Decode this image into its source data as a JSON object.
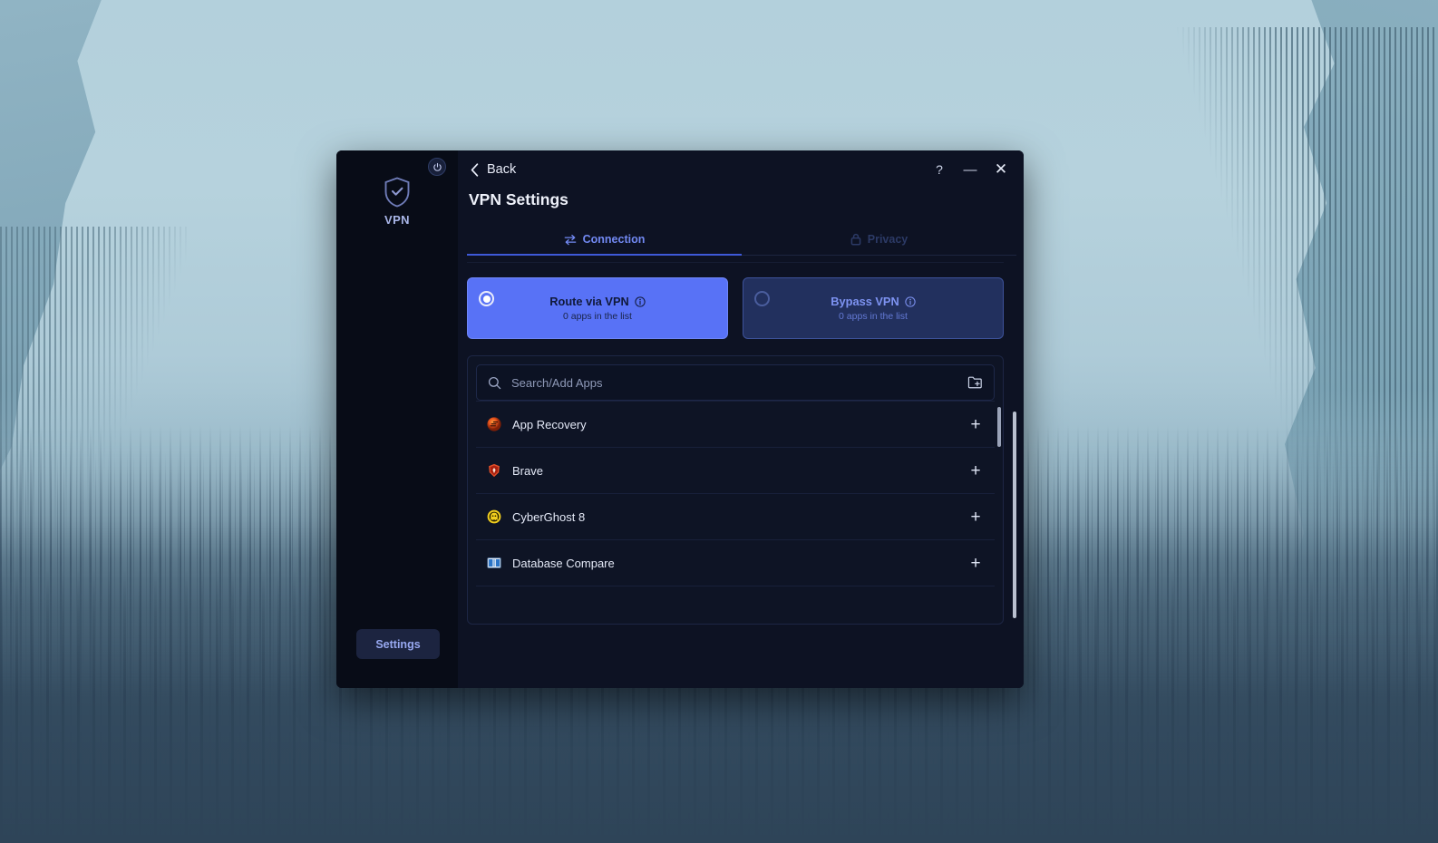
{
  "window": {
    "back_label": "Back",
    "page_title": "VPN Settings",
    "help_label": "?",
    "minimize_label": "—",
    "close_label": "✕"
  },
  "sidebar": {
    "vpn_label": "VPN",
    "settings_label": "Settings",
    "power_icon": "power-icon",
    "shield_icon": "shield-check-icon"
  },
  "tabs": [
    {
      "label": "Connection",
      "icon": "transfer-arrows-icon",
      "active": true
    },
    {
      "label": "Privacy",
      "icon": "lock-icon",
      "active": false
    }
  ],
  "mode_cards": [
    {
      "title": "Route via VPN",
      "subtitle": "0 apps in the list",
      "selected": true,
      "info_icon": "info-icon"
    },
    {
      "title": "Bypass VPN",
      "subtitle": "0 apps in the list",
      "selected": false,
      "info_icon": "info-icon"
    }
  ],
  "apps_panel": {
    "search": {
      "placeholder": "Search/Add Apps",
      "value": "",
      "search_icon": "search-icon",
      "browse_icon": "folder-add-icon"
    },
    "add_button_label": "+",
    "rows": [
      {
        "name": "App Recovery",
        "icon": "app-recovery-icon"
      },
      {
        "name": "Brave",
        "icon": "brave-icon"
      },
      {
        "name": "CyberGhost 8",
        "icon": "cyberghost-icon"
      },
      {
        "name": "Database Compare",
        "icon": "database-compare-icon"
      }
    ]
  },
  "colors": {
    "accent": "#5872f6",
    "accent_text": "#7289f3",
    "window_bg": "#0d1223",
    "sidebar_bg": "#080c17",
    "unselected_card": "#22305e"
  }
}
